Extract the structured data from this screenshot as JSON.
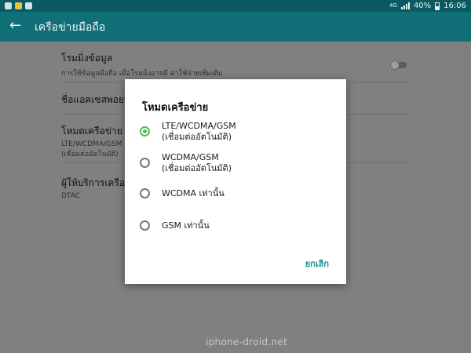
{
  "status_bar": {
    "network": "4G",
    "battery": "40%",
    "time": "16:06"
  },
  "app_bar": {
    "back_icon": "back-arrow-icon",
    "title": "เครือข่ายมือถือ"
  },
  "settings": {
    "roaming": {
      "title": "โรมมิ่งข้อมูล",
      "subtitle": "การใช้ข้อมูลมือถือ เมื่อโรมมิ่งอาจมี ค่าใช้จ่ายเพิ่มเติม"
    },
    "apn": {
      "title": "ชื่อแอคเซสพอยท"
    },
    "network_mode": {
      "title": "โหมดเครือข่าย",
      "subtitle_line1": "LTE/WCDMA/GSM",
      "subtitle_line2": "(เชื่อมต่ออัตโนมัติ)"
    },
    "operator": {
      "title": "ผู้ให้บริการเครือข่",
      "subtitle": "DTAC"
    }
  },
  "dialog": {
    "title": "โหมดเครือข่าย",
    "options": [
      {
        "line1": "LTE/WCDMA/GSM",
        "line2": "(เชื่อมต่ออัตโนมัติ)",
        "selected": true
      },
      {
        "line1": "WCDMA/GSM",
        "line2": "(เชื่อมต่ออัตโนมัติ)",
        "selected": false
      },
      {
        "line1": "WCDMA เท่านั้น",
        "line2": "",
        "selected": false
      },
      {
        "line1": "GSM เท่านั้น",
        "line2": "",
        "selected": false
      }
    ],
    "cancel_label": "ยกเลิก"
  },
  "watermark": "iphone-droid.net",
  "colors": {
    "status_bar": "#0b5a63",
    "app_bar": "#116f78",
    "accent": "#1d8f98",
    "radio_selected": "#4fbf5a"
  }
}
